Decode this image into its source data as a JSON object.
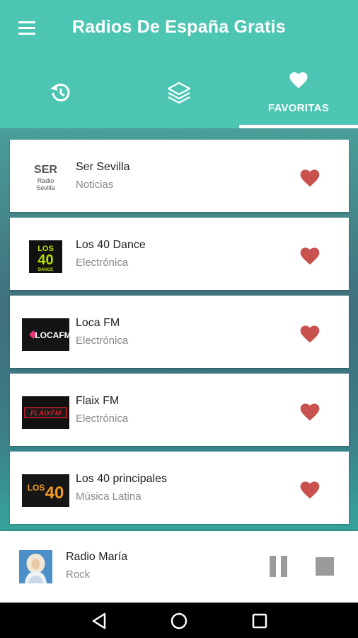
{
  "header": {
    "title": "Radios De España Gratis",
    "menu_icon": "hamburger-menu-icon"
  },
  "tabs": [
    {
      "icon": "history-icon",
      "label": ""
    },
    {
      "icon": "layers-icon",
      "label": ""
    },
    {
      "icon": "heart-icon",
      "label": "FAVORITAS",
      "active": true
    }
  ],
  "stations": [
    {
      "name": "Ser Sevilla",
      "genre": "Noticias",
      "logo": {
        "line1": "SER",
        "line2": "Radio",
        "line3": "Sevilla"
      }
    },
    {
      "name": "Los 40 Dance",
      "genre": "Electrónica",
      "logo": {
        "line1": "LOS",
        "line2": "40",
        "line3": "DANCE"
      }
    },
    {
      "name": "Loca FM",
      "genre": "Electrónica",
      "logo": {
        "line1": "LOCAFM"
      }
    },
    {
      "name": "Flaix FM",
      "genre": "Electrónica",
      "logo": {
        "line1": "FLAIXFM"
      }
    },
    {
      "name": "Los 40 principales",
      "genre": "Música Latina",
      "logo": {
        "line1": "LOS",
        "line2": "40"
      }
    }
  ],
  "player": {
    "title": "Radio María",
    "subtitle": "Rock"
  },
  "colors": {
    "accent": "#4cc6b3",
    "heart": "#c9524e",
    "controls": "#9b9b9b"
  }
}
